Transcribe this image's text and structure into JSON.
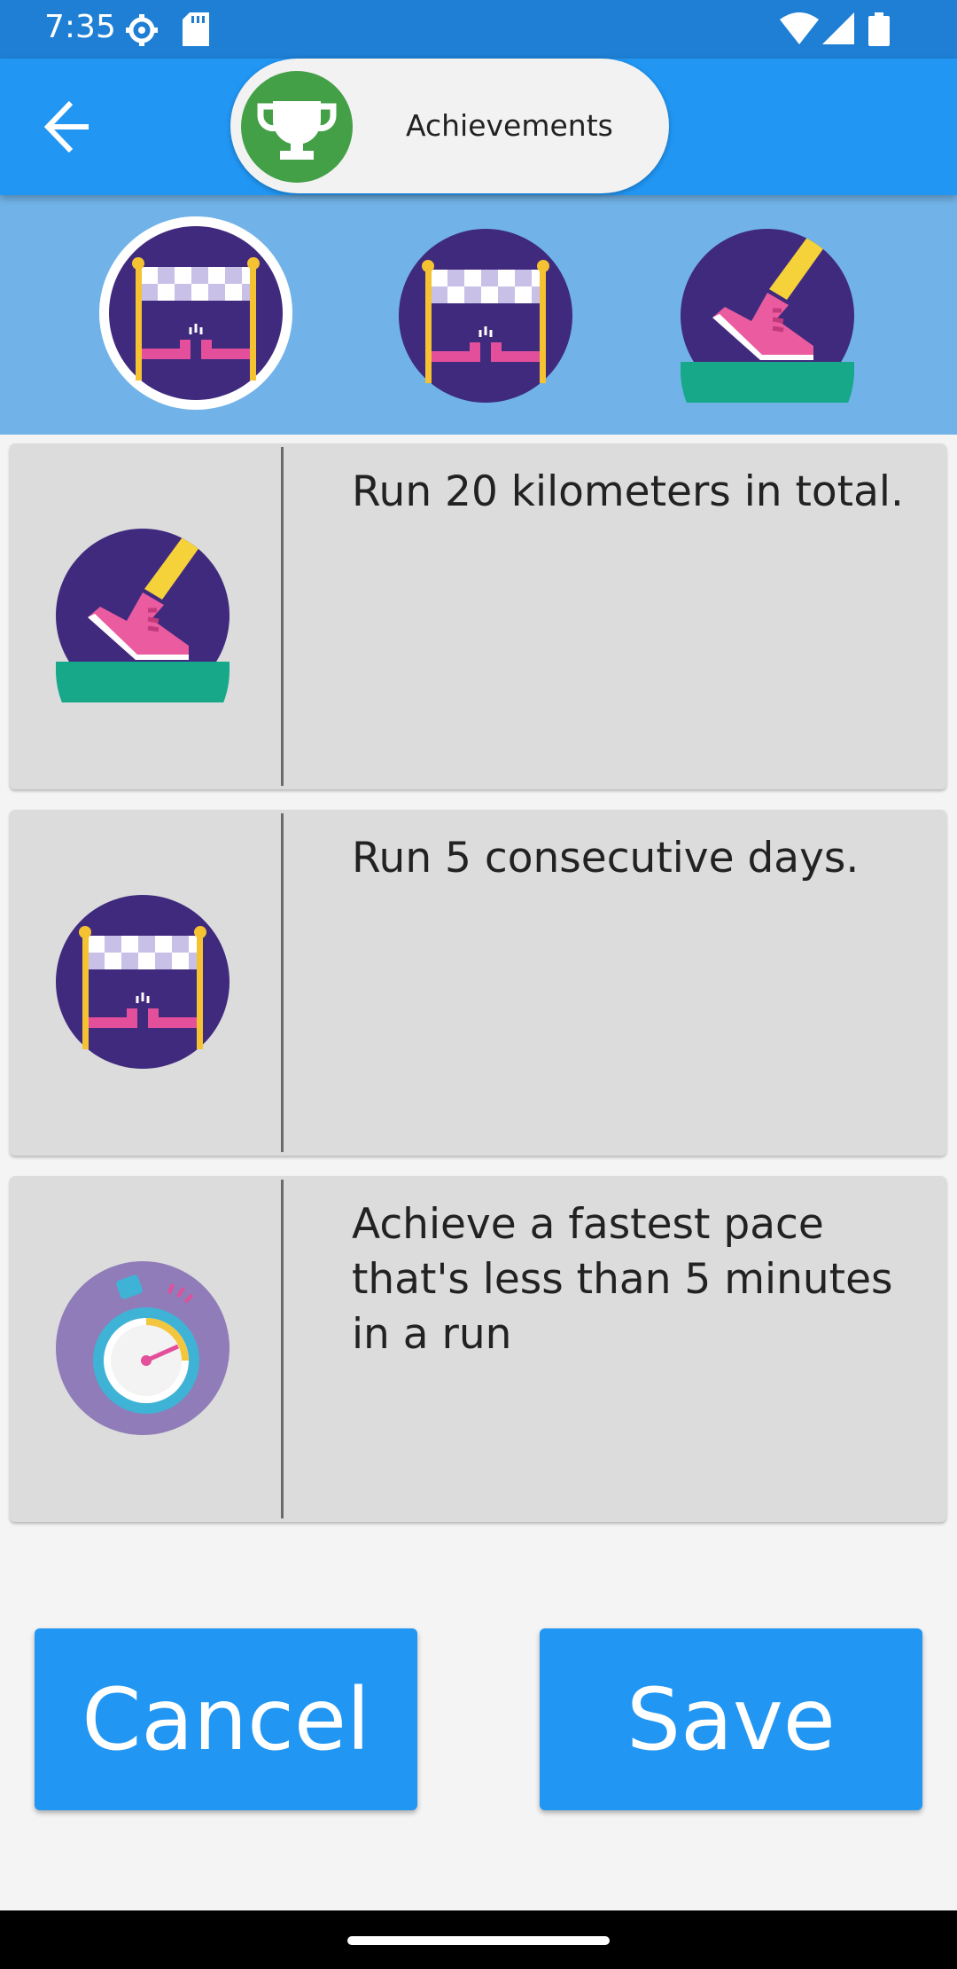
{
  "status_bar": {
    "time": "7:35",
    "icons": [
      "settings-icon",
      "sd-card-icon",
      "wifi-icon",
      "signal-icon",
      "battery-icon"
    ]
  },
  "app_bar": {
    "back_icon": "arrow-back-icon",
    "title": "Achievements",
    "title_icon": "trophy-icon"
  },
  "badges": [
    {
      "icon": "finish-line-badge-icon",
      "selected": true
    },
    {
      "icon": "finish-line-badge-icon",
      "selected": false
    },
    {
      "icon": "running-shoe-badge-icon",
      "selected": false
    }
  ],
  "achievements": [
    {
      "icon": "running-shoe-badge-icon",
      "text": "Run 20 kilometers in total."
    },
    {
      "icon": "finish-line-badge-icon",
      "text": "Run 5 consecutive days."
    },
    {
      "icon": "stopwatch-badge-icon",
      "text": "Achieve a fastest pace that's less than 5 minutes in a run"
    }
  ],
  "buttons": {
    "cancel": "Cancel",
    "save": "Save"
  },
  "colors": {
    "app_bar": "#2196f3",
    "status_bar": "#1e7fd4",
    "badge_strip": "#71b3e8",
    "card": "#dcdcdc",
    "button": "#2196f3",
    "trophy_circle": "#43a047"
  }
}
